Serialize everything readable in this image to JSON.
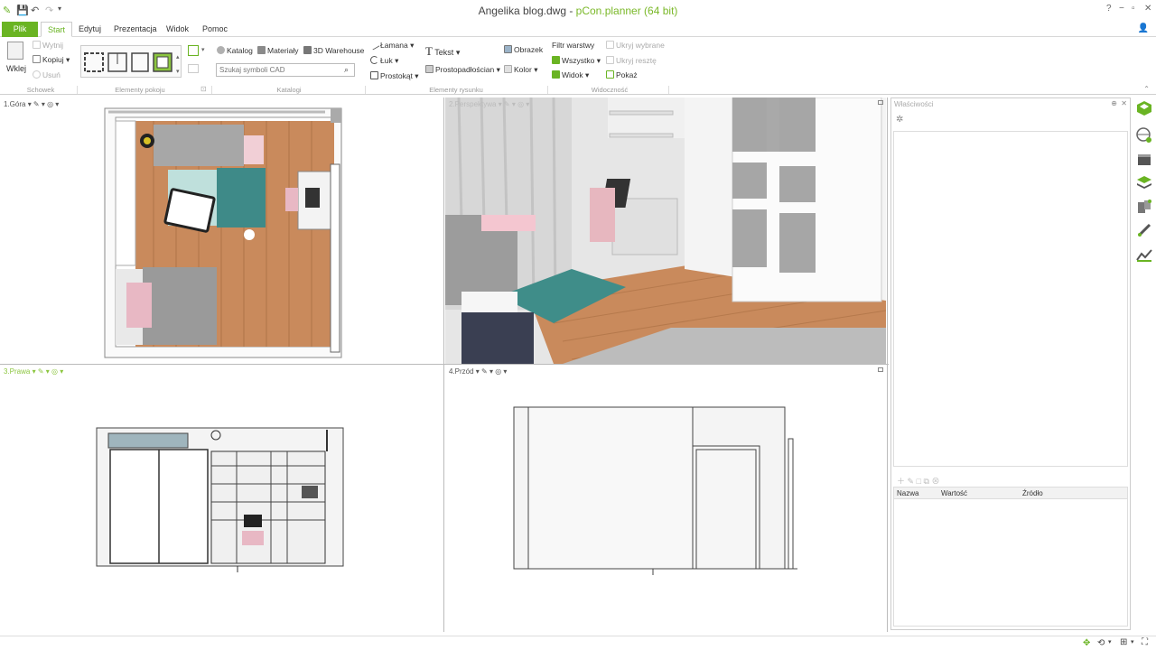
{
  "window": {
    "file_title": "Angelika blog.dwg - ",
    "app_title": "pCon.planner (64 bit)",
    "help": "?",
    "minimize": "−",
    "restore": "▫",
    "close": "✕"
  },
  "menu": {
    "file": "Plik",
    "tabs": [
      "Start",
      "Edytuj",
      "Prezentacja",
      "Widok",
      "Pomoc"
    ]
  },
  "ribbon": {
    "clipboard": {
      "paste": "Wklej",
      "cut": "Wytnij",
      "copy": "Kopiuj",
      "delete": "Usuń",
      "group": "Schowek"
    },
    "room_elements": {
      "group": "Elementy pokoju"
    },
    "catalog": {
      "catalog": "Katalog",
      "materials": "Materiały",
      "warehouse": "3D Warehouse",
      "search_placeholder": "Szukaj symboli CAD",
      "group": "Katalogi"
    },
    "drawing": {
      "polyline": "Łamana",
      "arc": "Łuk",
      "rectangle": "Prostokąt",
      "text": "Tekst",
      "cuboid": "Prostopadłościan",
      "image": "Obrazek",
      "color": "Kolor",
      "group": "Elementy rysunku"
    },
    "visibility": {
      "layer_filter": "Filtr warstwy",
      "all": "Wszystko",
      "view": "Widok",
      "hide_selected": "Ukryj wybrane",
      "hide_rest": "Ukryj resztę",
      "show": "Pokaż",
      "group": "Widoczność"
    }
  },
  "viewports": {
    "top": "1.Góra",
    "perspective": "2.Perspektywa",
    "right": "3.Prawa",
    "front": "4.Przód",
    "label_suffix": " ▾ ✎ ▾ ◎ ▾"
  },
  "properties": {
    "title": "Właściwości",
    "pin": "⊕",
    "close": "✕",
    "columns": [
      "Nazwa",
      "Wartość",
      "Źródło"
    ]
  },
  "colors": {
    "accent": "#6ab423",
    "floor": "#c98a5c",
    "rug": "#3e8a88"
  }
}
